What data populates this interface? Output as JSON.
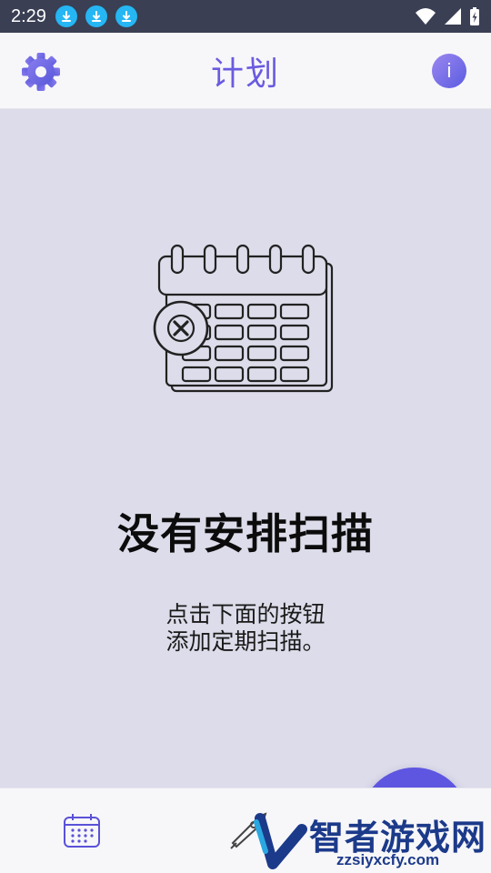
{
  "status_bar": {
    "time": "2:29",
    "icons": [
      "download-icon",
      "download-icon",
      "download-icon",
      "wifi-icon",
      "signal-icon",
      "battery-icon"
    ]
  },
  "app_bar": {
    "title": "计划",
    "left_icon": "gear-icon",
    "right_icon": "info-icon",
    "right_label": "i"
  },
  "empty_state": {
    "illustration": "calendar-x-icon",
    "title": "没有安排扫描",
    "description_lines": [
      "点击下面的按钮",
      "添加定期扫描。"
    ]
  },
  "fab": {
    "icon": "plus-icon"
  },
  "bottom_nav": {
    "items": [
      "calendar-icon",
      "scan-icon"
    ]
  },
  "watermark": {
    "text": "智者游戏网",
    "url": "zzsiyxcfy.com"
  },
  "colors": {
    "accent": "#6a5be0",
    "fab": "#5e56e0",
    "background": "#dcdcea",
    "status_bar": "#3a3f54",
    "download_badge": "#25b6f3"
  }
}
